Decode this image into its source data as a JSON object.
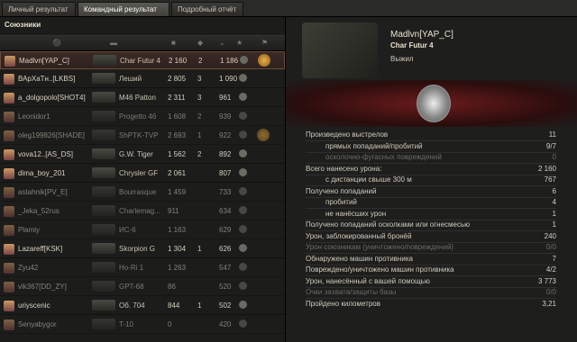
{
  "tabs": [
    "Личный результат",
    "Командный результат",
    "Подробный отчёт"
  ],
  "team_title": "Союзники",
  "rows": [
    {
      "player": "Madlvn[YAP_C]",
      "tank": "Char Futur 4",
      "damage": "2 160",
      "kills": "2",
      "xp": "1 186",
      "sel": true,
      "dead": false,
      "achv": true
    },
    {
      "player": "ВАрХаТн..[LKBS]",
      "tank": "Леший",
      "damage": "2 805",
      "kills": "3",
      "xp": "1 090",
      "sel": false,
      "dead": false,
      "achv": false
    },
    {
      "player": "a_dolgopolo[SHOT4]",
      "tank": "M46 Patton",
      "damage": "2 311",
      "kills": "3",
      "xp": "961",
      "sel": false,
      "dead": false,
      "achv": false
    },
    {
      "player": "Leonidor1",
      "tank": "Progetto 46",
      "damage": "1 608",
      "kills": "2",
      "xp": "939",
      "sel": false,
      "dead": true,
      "achv": false
    },
    {
      "player": "oleg199826[SHADE]",
      "tank": "ShPTK-TVP",
      "damage": "2 693",
      "kills": "1",
      "xp": "922",
      "sel": false,
      "dead": true,
      "achv": true
    },
    {
      "player": "vova12..[AS_DS]",
      "tank": "G.W. Tiger",
      "damage": "1 562",
      "kills": "2",
      "xp": "892",
      "sel": false,
      "dead": false,
      "achv": false
    },
    {
      "player": "dima_boy_201",
      "tank": "Chrysler GF",
      "damage": "2 061",
      "kills": "",
      "xp": "807",
      "sel": false,
      "dead": false,
      "achv": false
    },
    {
      "player": "astahnik[PV_E]",
      "tank": "Bourrasque",
      "damage": "1 459",
      "kills": "",
      "xp": "733",
      "sel": false,
      "dead": true,
      "achv": false
    },
    {
      "player": "_Jeka_52rus",
      "tank": "Charlemag...",
      "damage": "911",
      "kills": "",
      "xp": "634",
      "sel": false,
      "dead": true,
      "achv": false
    },
    {
      "player": "Plamiy",
      "tank": "ИС-6",
      "damage": "1 163",
      "kills": "",
      "xp": "629",
      "sel": false,
      "dead": true,
      "achv": false
    },
    {
      "player": "Lazareff[KSK]",
      "tank": "Skorpion G",
      "damage": "1 304",
      "kills": "1",
      "xp": "626",
      "sel": false,
      "dead": false,
      "achv": false
    },
    {
      "player": "Zyu42",
      "tank": "Ho-Ri 1",
      "damage": "1 263",
      "kills": "",
      "xp": "547",
      "sel": false,
      "dead": true,
      "achv": false
    },
    {
      "player": "vik367[DD_ZY]",
      "tank": "GPT-68",
      "damage": "86",
      "kills": "",
      "xp": "520",
      "sel": false,
      "dead": true,
      "achv": false
    },
    {
      "player": "uriyscenic",
      "tank": "Об. 704",
      "damage": "844",
      "kills": "1",
      "xp": "502",
      "sel": false,
      "dead": false,
      "achv": false
    },
    {
      "player": "Senyabygor",
      "tank": "T-10",
      "damage": "0",
      "kills": "",
      "xp": "420",
      "sel": false,
      "dead": true,
      "achv": false
    }
  ],
  "detail": {
    "player": "Madlvn[YAP_C]",
    "tank": "Char Futur 4",
    "status": "Выжил",
    "stats": [
      {
        "label": "Произведено выстрелов",
        "value": "11",
        "indent": false,
        "dim": false
      },
      {
        "label": "прямых попаданий/пробитий",
        "value": "9/7",
        "indent": true,
        "dim": false
      },
      {
        "label": "осколочно-фугасных повреждений",
        "value": "0",
        "indent": true,
        "dim": true
      },
      {
        "label": "Всего нанесено урона:",
        "value": "2 160",
        "indent": false,
        "dim": false
      },
      {
        "label": "с дистанции свыше 300 м",
        "value": "767",
        "indent": true,
        "dim": false
      },
      {
        "label": "Получено попаданий",
        "value": "6",
        "indent": false,
        "dim": false
      },
      {
        "label": "пробитий",
        "value": "4",
        "indent": true,
        "dim": false
      },
      {
        "label": "не нанёсших урон",
        "value": "1",
        "indent": true,
        "dim": false
      },
      {
        "label": "Получено попаданий осколками или огнесмесью",
        "value": "1",
        "indent": false,
        "dim": false
      },
      {
        "label": "Урон, заблокированный бронёй",
        "value": "240",
        "indent": false,
        "dim": false
      },
      {
        "label": "Урон союзникам (уничтожено/повреждений)",
        "value": "0/0",
        "indent": false,
        "dim": true
      },
      {
        "label": "Обнаружено машин противника",
        "value": "7",
        "indent": false,
        "dim": false
      },
      {
        "label": "Повреждено/уничтожено машин противника",
        "value": "4/2",
        "indent": false,
        "dim": false
      },
      {
        "label": "Урон, нанесённый с вашей помощью",
        "value": "3 773",
        "indent": false,
        "dim": false
      },
      {
        "label": "Очки захвата/защиты базы",
        "value": "0/0",
        "indent": false,
        "dim": true
      },
      {
        "label": "Пройдено километров",
        "value": "3,21",
        "indent": false,
        "dim": false
      }
    ]
  }
}
